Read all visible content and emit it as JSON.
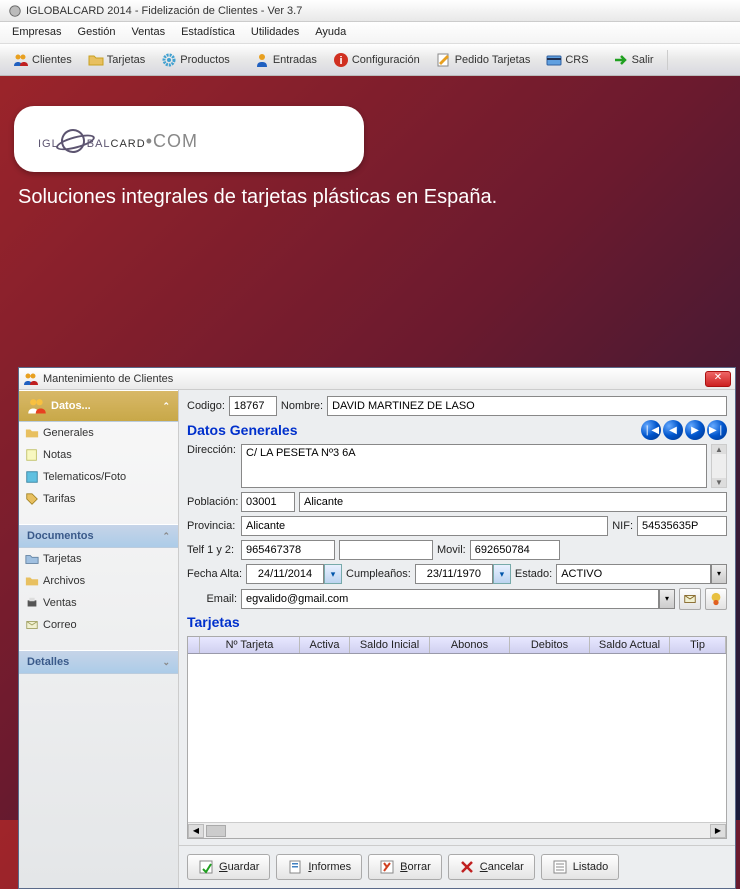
{
  "app_title": "IGLOBALCARD 2014 - Fidelización de Clientes - Ver 3.7",
  "menu": {
    "empresas": "Empresas",
    "gestion": "Gestión",
    "ventas": "Ventas",
    "estadistica": "Estadística",
    "utilidades": "Utilidades",
    "ayuda": "Ayuda"
  },
  "toolbar": {
    "clientes": "Clientes",
    "tarjetas": "Tarjetas",
    "productos": "Productos",
    "entradas": "Entradas",
    "configuracion": "Configuración",
    "pedido": "Pedido Tarjetas",
    "crs": "CRS",
    "salir": "Salir"
  },
  "logo": {
    "pre": "IGL",
    "post": "BAL",
    "card": "CARD",
    "dot": "•",
    "com": "COM"
  },
  "tagline": "Soluciones integrales de tarjetas plásticas en España.",
  "child": {
    "title": "Mantenimiento de Clientes",
    "sidebar": {
      "datos": "Datos...",
      "items1": [
        "Generales",
        "Notas",
        "Telematicos/Foto",
        "Tarifas"
      ],
      "documentos": "Documentos",
      "items2": [
        "Tarjetas",
        "Archivos",
        "Ventas",
        "Correo"
      ],
      "detalles": "Detalles"
    },
    "labels": {
      "codigo": "Codigo:",
      "nombre": "Nombre:",
      "datos_generales": "Datos Generales",
      "direccion": "Dirección:",
      "poblacion": "Población:",
      "provincia": "Provincia:",
      "nif": "NIF:",
      "telf": "Telf 1 y 2:",
      "movil": "Movil:",
      "fecha_alta": "Fecha Alta:",
      "cumpleanos": "Cumpleaños:",
      "estado": "Estado:",
      "email": "Email:",
      "tarjetas": "Tarjetas"
    },
    "values": {
      "codigo": "18767",
      "nombre": "DAVID MARTINEZ DE LASO",
      "direccion": "C/ LA PESETA Nº3 6A",
      "cp": "03001",
      "poblacion": "Alicante",
      "provincia": "Alicante",
      "nif": "54535635P",
      "telf1": "965467378",
      "telf2": "",
      "movil": "692650784",
      "fecha_alta": "24/11/2014",
      "cumpleanos": "23/11/1970",
      "estado": "ACTIVO",
      "email": "egvalido@gmail.com"
    },
    "grid_cols": [
      "Nº Tarjeta",
      "Activa",
      "Saldo Inicial",
      "Abonos",
      "Debitos",
      "Saldo Actual",
      "Tip"
    ],
    "buttons": {
      "guardar": "Guardar",
      "informes": "Informes",
      "borrar": "Borrar",
      "cancelar": "Cancelar",
      "listado": "Listado"
    }
  }
}
